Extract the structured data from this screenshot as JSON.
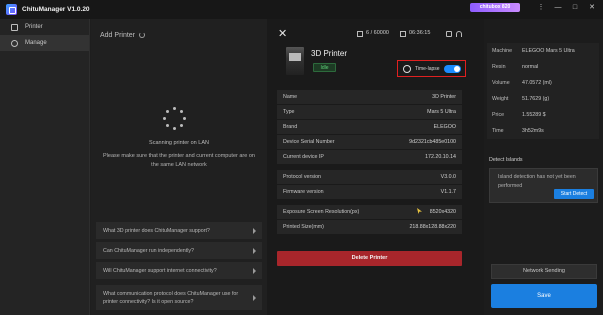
{
  "app": {
    "title": "ChituManager V1.0.20",
    "promo_label": "chitubox 820"
  },
  "sidebar": {
    "items": [
      {
        "label": "Printer"
      },
      {
        "label": "Manage"
      }
    ]
  },
  "add_printer": {
    "title": "Add Printer",
    "status": "Scanning printer on LAN",
    "note": "Please make sure that the printer and current computer are on the same LAN network",
    "faqs": [
      "What 3D printer does ChituManager support?",
      "Can ChituManager run independently?",
      "Will ChituManager support internet connectivity?",
      "What communication protocol does ChituManager use for printer connectivity? Is it open source?"
    ]
  },
  "toolbar": {
    "storage": "6 / 60000",
    "timer": "06:36:15"
  },
  "printer": {
    "name": "3D Printer",
    "status": "Idle",
    "time_lapse_label": "Time-lapse",
    "time_lapse_on": true,
    "info": [
      {
        "key": "Name",
        "value": "3D Printer"
      },
      {
        "key": "Type",
        "value": "Mars 5 Ultra"
      },
      {
        "key": "Brand",
        "value": "ELEGOO"
      },
      {
        "key": "Device Serial Number",
        "value": "9d2321cb485e0100"
      },
      {
        "key": "Current device IP",
        "value": "172.20.10.14"
      },
      {
        "key": "Protocol version",
        "value": "V3.0.0"
      },
      {
        "key": "Firmware version",
        "value": "V1.1.7"
      },
      {
        "key": "Exposure Screen Resolution(px)",
        "value": "8520x4320"
      },
      {
        "key": "Printed Size(mm)",
        "value": "218.88x128.88x220"
      }
    ],
    "delete_label": "Delete Printer"
  },
  "right_panel": {
    "details": [
      {
        "key": "Machine",
        "value": "ELEGOO Mars 5 Ultra"
      },
      {
        "key": "Resin",
        "value": "normal"
      },
      {
        "key": "Volume",
        "value": "47.0572 (ml)"
      },
      {
        "key": "Weight",
        "value": "51.7629 (g)"
      },
      {
        "key": "Price",
        "value": "1.55289 $"
      },
      {
        "key": "Time",
        "value": "3h52m9s"
      }
    ],
    "detect_title": "Detect Islands",
    "detect_text": "Island detection has not yet been performed",
    "start_detect": "Start Detect",
    "network_sending": "Network Sending",
    "save": "Save"
  },
  "colors": {
    "accent": "#1b7fe0",
    "danger": "#a8262b",
    "highlight": "#e02020",
    "idle": "#5fd07a"
  }
}
